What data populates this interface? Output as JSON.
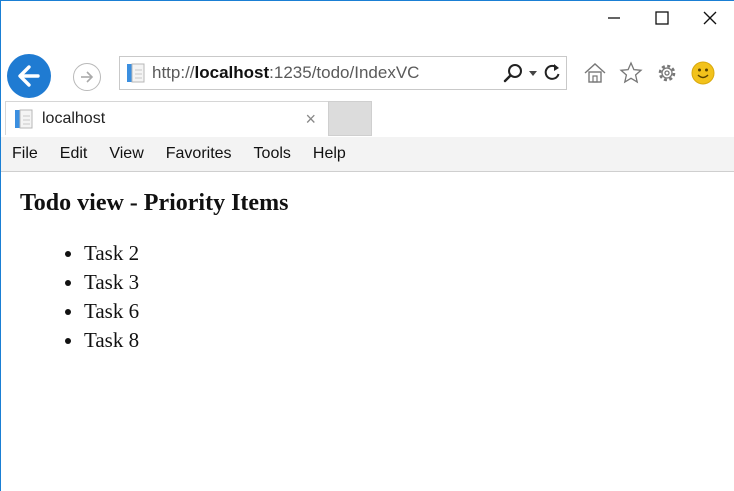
{
  "window": {
    "controls": {
      "minimize_icon": "minimize-icon",
      "maximize_icon": "maximize-icon",
      "close_icon": "close-icon"
    }
  },
  "address_bar": {
    "url_prefix": "http://",
    "url_host": "localhost",
    "url_rest": ":1235/todo/IndexVC"
  },
  "tab": {
    "title": "localhost",
    "close": "×"
  },
  "menu": {
    "items": [
      "File",
      "Edit",
      "View",
      "Favorites",
      "Tools",
      "Help"
    ]
  },
  "page": {
    "heading": "Todo view - Priority Items",
    "items": [
      "Task 2",
      "Task 3",
      "Task 6",
      "Task 8"
    ]
  },
  "colors": {
    "accent": "#1f7bd2",
    "smiley": "#f2c21b"
  }
}
